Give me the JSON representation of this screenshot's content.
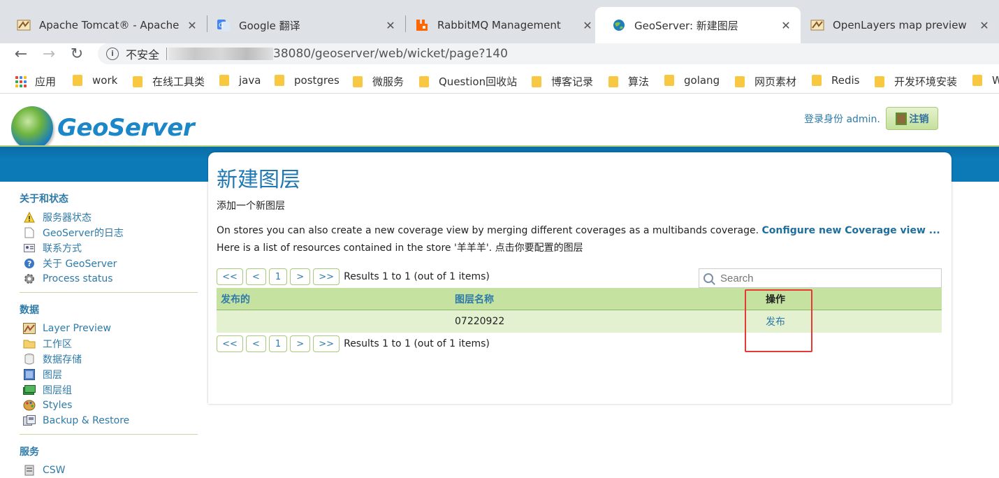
{
  "browser": {
    "tabs": [
      {
        "title": "Apache Tomcat® - Apache Tomcat 8",
        "close": "✕"
      },
      {
        "title": "Google 翻译",
        "close": "✕"
      },
      {
        "title": "RabbitMQ Management",
        "close": "✕"
      },
      {
        "title": "GeoServer: 新建图层",
        "close": "✕"
      },
      {
        "title": "OpenLayers map preview",
        "close": "✕"
      }
    ],
    "address": {
      "security_label": "不安全",
      "url_visible": "38080/geoserver/web/wicket/page?140"
    },
    "bookmarks": [
      "应用",
      "work",
      "在线工具类",
      "java",
      "postgres",
      "微服务",
      "Question回收站",
      "博客记录",
      "算法",
      "golang",
      "网页素材",
      "Redis",
      "开发环境安装",
      "W"
    ]
  },
  "header": {
    "logo_text": "GeoServer",
    "login_info": "登录身份 admin.",
    "logout_label": "注销"
  },
  "sidebar": {
    "sections": [
      {
        "title": "关于和状态",
        "items": [
          {
            "label": "服务器状态",
            "icon": "warning-icon"
          },
          {
            "label": "GeoServer的日志",
            "icon": "document-icon"
          },
          {
            "label": "联系方式",
            "icon": "contact-card-icon"
          },
          {
            "label": "关于 GeoServer",
            "icon": "help-icon"
          },
          {
            "label": "Process status",
            "icon": "gear-icon"
          }
        ]
      },
      {
        "title": "数据",
        "items": [
          {
            "label": "Layer Preview",
            "icon": "map-preview-icon"
          },
          {
            "label": "工作区",
            "icon": "folder-icon"
          },
          {
            "label": "数据存储",
            "icon": "database-icon"
          },
          {
            "label": "图层",
            "icon": "layer-icon"
          },
          {
            "label": "图层组",
            "icon": "layer-group-icon"
          },
          {
            "label": "Styles",
            "icon": "palette-icon"
          },
          {
            "label": "Backup & Restore",
            "icon": "backup-icon"
          }
        ]
      },
      {
        "title": "服务",
        "items": [
          {
            "label": "CSW",
            "icon": "server-icon"
          }
        ]
      }
    ]
  },
  "main": {
    "title": "新建图层",
    "subtitle": "添加一个新图层",
    "description_prefix": "On stores you can also create a new coverage view by merging different coverages as a multibands coverage.",
    "description_link": "Configure new Coverage view ...",
    "store_line": "Here is a list of resources contained in the store '羊羊羊'. 点击你要配置的图层",
    "pager": {
      "first": "<<",
      "prev": "<",
      "page": "1",
      "next": ">",
      "last": ">>",
      "results": "Results 1 to 1 (out of 1 items)"
    },
    "search_placeholder": "Search",
    "table": {
      "headers": [
        "发布的",
        "图层名称",
        "操作"
      ],
      "rows": [
        {
          "published": "",
          "name": "07220922",
          "action": "发布"
        }
      ]
    }
  }
}
